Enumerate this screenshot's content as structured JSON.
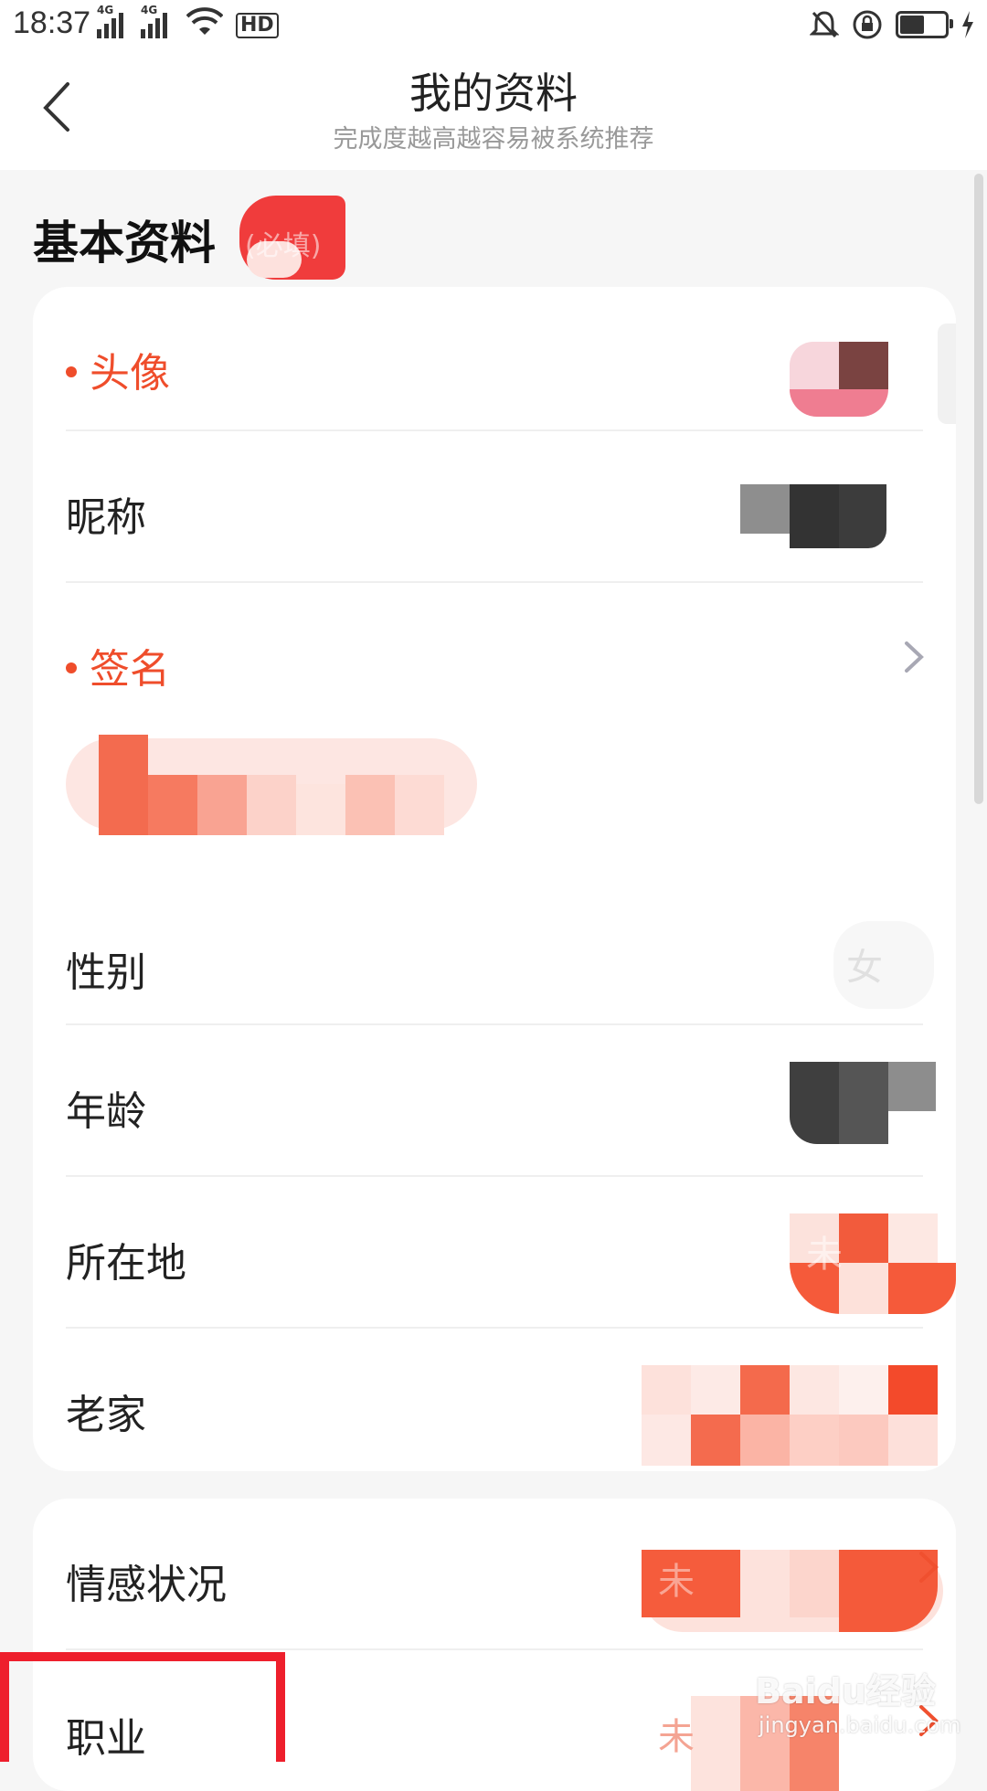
{
  "status_bar": {
    "time": "18:37",
    "network_tags": [
      "4G",
      "4G"
    ],
    "hd_label": "HD"
  },
  "header": {
    "title": "我的资料",
    "subtitle": "完成度越高越容易被系统推荐"
  },
  "basic_section": {
    "title": "基本资料",
    "badge_text": "(必填)"
  },
  "basic_rows": [
    {
      "label": "头像",
      "required": true
    },
    {
      "label": "昵称",
      "required": false
    },
    {
      "label": "签名",
      "required": true
    },
    {
      "label": "性别",
      "required": false,
      "value": "女"
    },
    {
      "label": "年龄",
      "required": false
    },
    {
      "label": "所在地",
      "required": false,
      "value": "未"
    },
    {
      "label": "老家",
      "required": false
    }
  ],
  "other_rows": [
    {
      "label": "情感状况",
      "value": "未"
    },
    {
      "label": "职业",
      "value": "未"
    }
  ],
  "watermark": {
    "brand": "Baidu经验",
    "url": "jingyan.baidu.com"
  },
  "colors": {
    "accent": "#ef4d2b",
    "highlight_box": "#ee1f2c",
    "background": "#f6f6f6"
  }
}
